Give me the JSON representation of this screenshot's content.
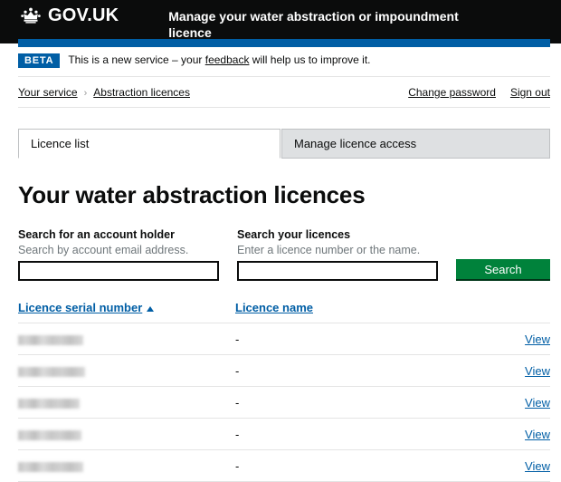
{
  "header": {
    "logo_text": "GOV.UK",
    "crown_icon": "crown-icon",
    "service_name": "Manage your water abstraction or impoundment licence",
    "colors": {
      "background": "#0b0c0c",
      "accent_bar": "#005ea5"
    }
  },
  "phase_banner": {
    "tag": "BETA",
    "text_before": "This is a new service – your",
    "link": "feedback",
    "text_after": "will help us to improve it."
  },
  "breadcrumb": {
    "items": [
      {
        "label": "Your service"
      },
      {
        "label": "Abstraction licences"
      }
    ],
    "separator": "›"
  },
  "account_links": [
    {
      "label": "Change password"
    },
    {
      "label": "Sign out"
    }
  ],
  "tabs": [
    {
      "label": "Licence list",
      "active": true
    },
    {
      "label": "Manage licence access",
      "active": false
    }
  ],
  "main": {
    "page_title": "Your water abstraction licences",
    "search": {
      "account_holder": {
        "label": "Search for an account holder",
        "hint": "Search by account email address.",
        "value": "",
        "placeholder": ""
      },
      "licences": {
        "label": "Search your licences",
        "hint": "Enter a licence number or the name.",
        "value": "",
        "placeholder": ""
      },
      "submit_label": "Search",
      "button_color": "#00823b"
    },
    "table": {
      "columns": [
        {
          "label": "Licence serial number",
          "sortable": true,
          "sort_direction": "ascending"
        },
        {
          "label": "Licence name",
          "sortable": true,
          "sort_direction": "none"
        },
        {
          "label": "",
          "sortable": false
        }
      ],
      "rows": [
        {
          "serial": "",
          "serial_redacted": true,
          "redaction_width": 72,
          "name": "-",
          "action": "View"
        },
        {
          "serial": "",
          "serial_redacted": true,
          "redaction_width": 74,
          "name": "-",
          "action": "View"
        },
        {
          "serial": "",
          "serial_redacted": true,
          "redaction_width": 68,
          "name": "-",
          "action": "View"
        },
        {
          "serial": "",
          "serial_redacted": true,
          "redaction_width": 70,
          "name": "-",
          "action": "View"
        },
        {
          "serial": "",
          "serial_redacted": true,
          "redaction_width": 72,
          "name": "-",
          "action": "View"
        }
      ]
    }
  }
}
